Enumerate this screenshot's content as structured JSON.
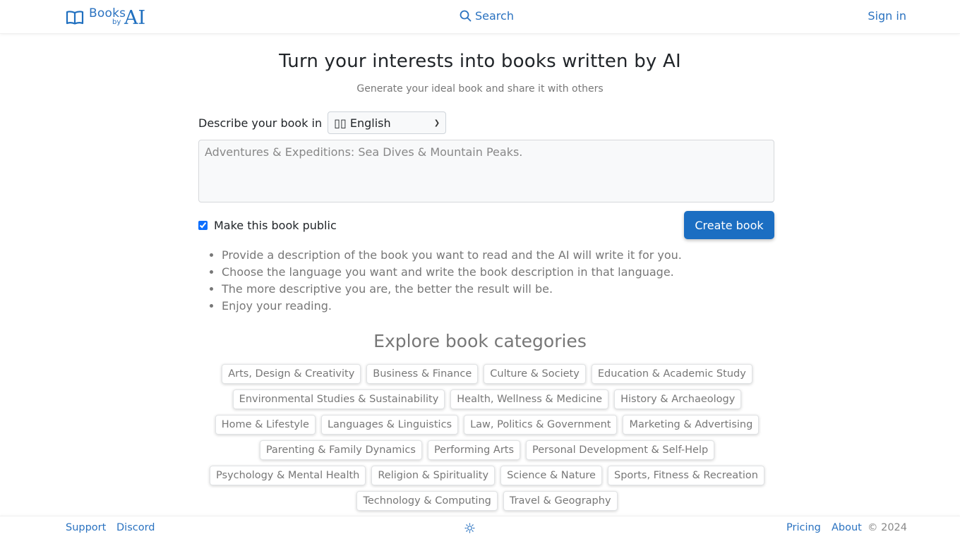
{
  "header": {
    "logo": {
      "books": "Books",
      "by": "by",
      "ai": "AI"
    },
    "search_label": "Search",
    "signin_label": "Sign in"
  },
  "hero": {
    "title": "Turn your interests into books written by AI",
    "subtitle": "Generate your ideal book and share it with others"
  },
  "form": {
    "language_label": "Describe your book in",
    "language_selected": "▯▯ English",
    "description_value": "",
    "description_placeholder": "Adventures & Expeditions: Sea Dives & Mountain Peaks.",
    "public_label": "Make this book public",
    "public_checked": true,
    "create_label": "Create book"
  },
  "tips": [
    "Provide a description of the book you want to read and the AI will write it for you.",
    "Choose the language you want and write the book description in that language.",
    "The more descriptive you are, the better the result will be.",
    "Enjoy your reading."
  ],
  "explore": {
    "title": "Explore book categories",
    "rows": [
      [
        "Arts, Design & Creativity",
        "Business & Finance",
        "Culture & Society",
        "Education & Academic Study"
      ],
      [
        "Environmental Studies & Sustainability",
        "Health, Wellness & Medicine",
        "History & Archaeology"
      ],
      [
        "Home & Lifestyle",
        "Languages & Linguistics",
        "Law, Politics & Government",
        "Marketing & Advertising"
      ],
      [
        "Parenting & Family Dynamics",
        "Performing Arts",
        "Personal Development & Self-Help"
      ],
      [
        "Psychology & Mental Health",
        "Religion & Spirituality",
        "Science & Nature",
        "Sports, Fitness & Recreation"
      ],
      [
        "Technology & Computing",
        "Travel & Geography"
      ]
    ]
  },
  "footer": {
    "support_label": "Support",
    "discord_label": "Discord",
    "theme_icon": "sun-icon",
    "pricing_label": "Pricing",
    "about_label": "About",
    "copyright": "© 2024"
  },
  "colors": {
    "accent": "#1b6ec2",
    "link": "#2a72c0",
    "muted_text": "#777777"
  }
}
